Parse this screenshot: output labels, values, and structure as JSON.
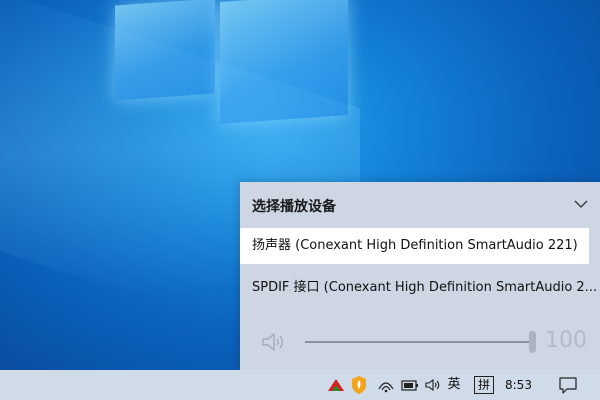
{
  "flyout": {
    "title": "选择播放设备",
    "devices": [
      {
        "label": "扬声器 (Conexant High Definition SmartAudio 221)",
        "selected": true
      },
      {
        "label": "SPDIF 接口 (Conexant High Definition SmartAudio 2...",
        "selected": false
      }
    ],
    "volume": {
      "value": "100",
      "level": 1.0,
      "icon": "speaker-icon"
    }
  },
  "taskbar": {
    "tray_icons": [
      "nvidia-icon",
      "security-shield-icon",
      "wifi-icon",
      "battery-icon",
      "volume-icon"
    ],
    "input_language": "英",
    "ime_mode": "拼",
    "clock": "8:53",
    "notification_icon": "notification-center-icon"
  },
  "colors": {
    "desktop_blue": "#0b63bd",
    "flyout_bg": "#cdd6e2",
    "selected_bg": "#ffffff",
    "taskbar_bg": "#cfdbe8"
  }
}
